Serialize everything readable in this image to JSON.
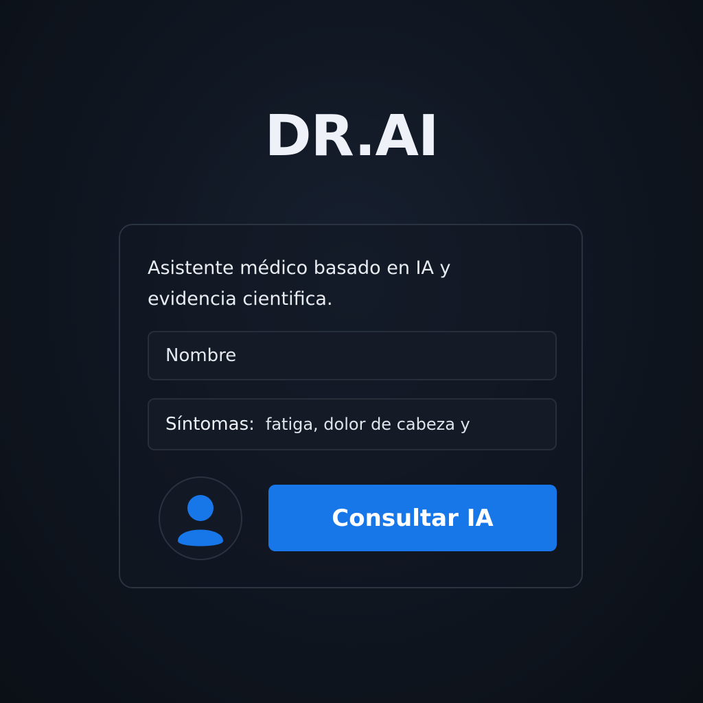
{
  "app": {
    "title": "DR.AI"
  },
  "card": {
    "description": "Asistente médico basado en IA y evidencia cientifica.",
    "name_field": {
      "placeholder": "Nombre"
    },
    "symptoms_field": {
      "label": "Síntomas:",
      "value": "fatiga, dolor de cabeza y"
    },
    "avatar_icon": "user-icon",
    "consult_button": {
      "label": "Consultar IA"
    }
  },
  "colors": {
    "accent": "#1877e8",
    "background": "#101722",
    "card_border": "#2a3340",
    "text": "#eef1f8"
  }
}
